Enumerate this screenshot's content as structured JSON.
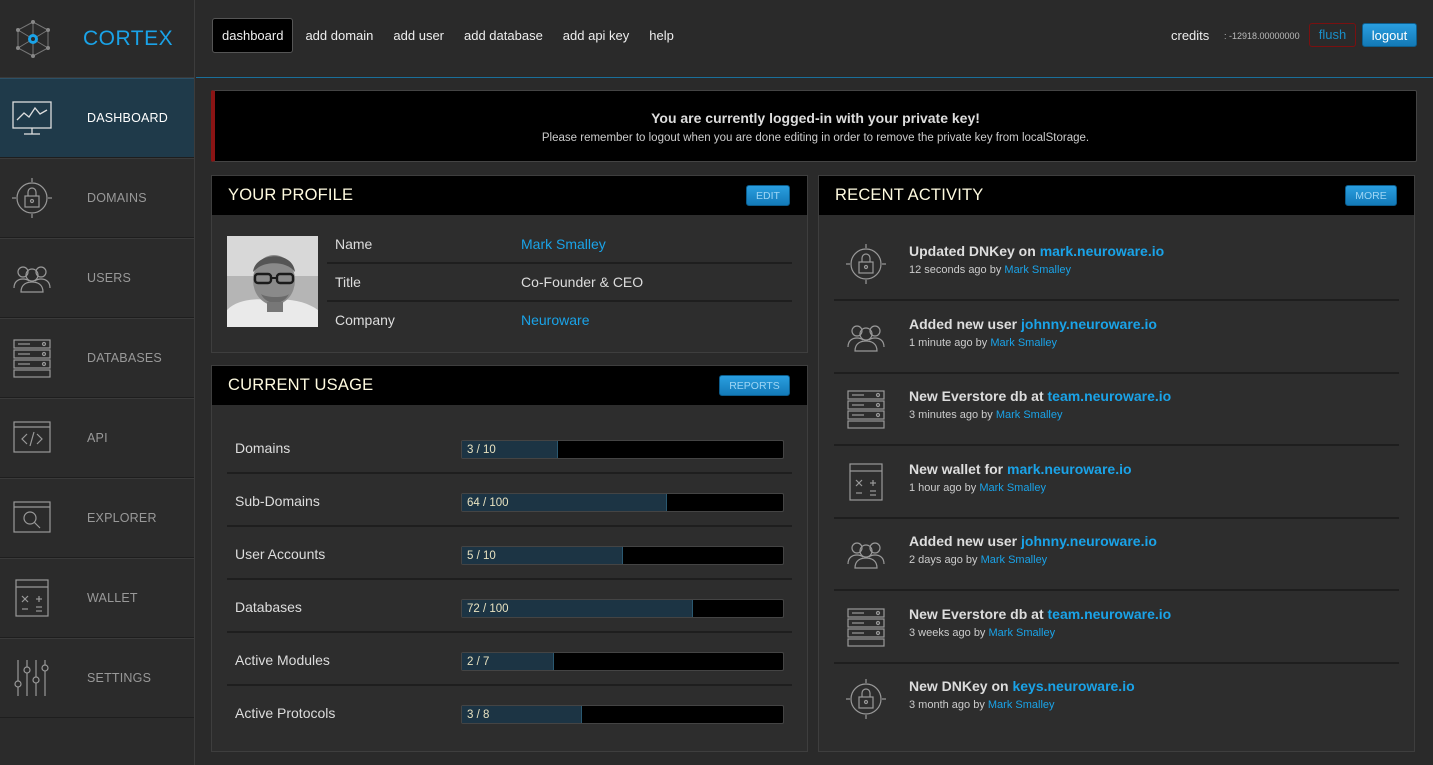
{
  "app": {
    "name": "CORTEX",
    "accent": "#1aa3e8"
  },
  "sidebar": {
    "items": [
      {
        "label": "DASHBOARD",
        "icon": "dashboard-monitor-icon",
        "active": true
      },
      {
        "label": "DOMAINS",
        "icon": "domain-lock-icon"
      },
      {
        "label": "USERS",
        "icon": "users-group-icon"
      },
      {
        "label": "DATABASES",
        "icon": "database-server-icon"
      },
      {
        "label": "API",
        "icon": "code-window-icon"
      },
      {
        "label": "EXPLORER",
        "icon": "search-window-icon"
      },
      {
        "label": "WALLET",
        "icon": "calculator-wallet-icon"
      },
      {
        "label": "SETTINGS",
        "icon": "sliders-icon"
      }
    ]
  },
  "topnav": {
    "items": [
      "dashboard",
      "add domain",
      "add user",
      "add database",
      "add api key",
      "help"
    ],
    "credits_label": "credits",
    "credits_value": ": -12918.00000000",
    "flush_label": "flush",
    "logout_label": "logout"
  },
  "alert": {
    "title": "You are currently logged-in with your private key!",
    "message": "Please remember to logout when you are done editing in order to remove the private key from localStorage."
  },
  "profile": {
    "title": "YOUR PROFILE",
    "edit_label": "EDIT",
    "rows": [
      {
        "key": "Name",
        "value": "Mark Smalley",
        "link": true
      },
      {
        "key": "Title",
        "value": "Co-Founder & CEO",
        "link": false
      },
      {
        "key": "Company",
        "value": "Neuroware",
        "link": true
      }
    ]
  },
  "usage": {
    "title": "CURRENT USAGE",
    "reports_label": "REPORTS",
    "rows": [
      {
        "label": "Domains",
        "text": "3 / 10",
        "fraction": 0.3
      },
      {
        "label": "Sub-Domains",
        "text": "64 / 100",
        "fraction": 0.64
      },
      {
        "label": "User Accounts",
        "text": "5 / 10",
        "fraction": 0.5
      },
      {
        "label": "Databases",
        "text": "72 / 100",
        "fraction": 0.72
      },
      {
        "label": "Active Modules",
        "text": "2 / 7",
        "fraction": 0.2857
      },
      {
        "label": "Active Protocols",
        "text": "3 / 8",
        "fraction": 0.375
      }
    ]
  },
  "activity": {
    "title": "RECENT ACTIVITY",
    "more_label": "MORE",
    "items": [
      {
        "icon": "domain-lock-icon",
        "action": "Updated DNKey on ",
        "target": "mark.neuroware.io",
        "time": "12 seconds ago by ",
        "user": "Mark Smalley"
      },
      {
        "icon": "users-group-icon",
        "action": "Added new user ",
        "target": "johnny.neuroware.io",
        "time": "1 minute ago by ",
        "user": "Mark Smalley"
      },
      {
        "icon": "database-server-icon",
        "action": "New Everstore db at ",
        "target": "team.neuroware.io",
        "time": "3 minutes ago by ",
        "user": "Mark Smalley"
      },
      {
        "icon": "calculator-wallet-icon",
        "action": "New wallet for ",
        "target": "mark.neuroware.io",
        "time": "1 hour ago by ",
        "user": "Mark Smalley"
      },
      {
        "icon": "users-group-icon",
        "action": "Added new user ",
        "target": "johnny.neuroware.io",
        "time": "2 days ago by ",
        "user": "Mark Smalley"
      },
      {
        "icon": "database-server-icon",
        "action": "New Everstore db at ",
        "target": "team.neuroware.io",
        "time": "3 weeks ago by ",
        "user": "Mark Smalley"
      },
      {
        "icon": "domain-lock-icon",
        "action": "New DNKey on ",
        "target": "keys.neuroware.io",
        "time": "3 month ago by ",
        "user": "Mark Smalley"
      }
    ]
  }
}
